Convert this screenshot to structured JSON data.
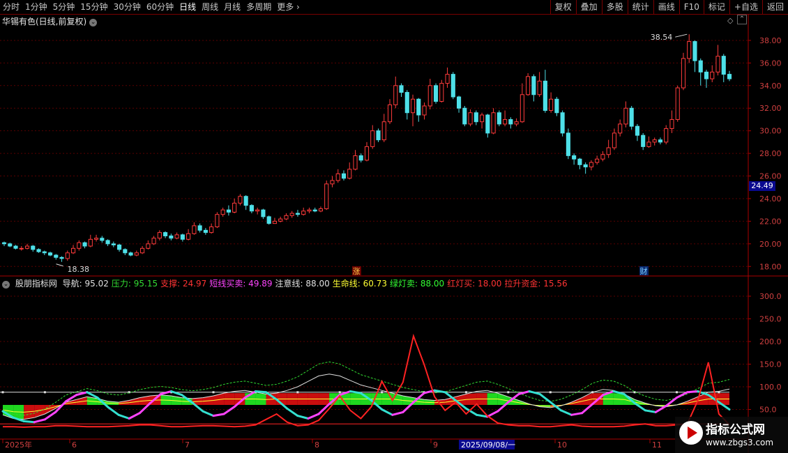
{
  "toolbar": {
    "tabs": [
      "分时",
      "1分钟",
      "5分钟",
      "15分钟",
      "30分钟",
      "60分钟",
      "日线",
      "周线",
      "月线",
      "多周期",
      "更多"
    ],
    "active_tab": "日线",
    "right_tabs": [
      "复权",
      "叠加",
      "多股",
      "统计",
      "画线",
      "F10",
      "标记",
      "+自选",
      "返回"
    ]
  },
  "chart_header": {
    "title": "华锡有色(日线,前复权)"
  },
  "indicator_header": {
    "name": "股朋指标网",
    "items": [
      {
        "label": "导航: 95.02",
        "color": "#e0e0e0"
      },
      {
        "label": "压力: 95.15",
        "color": "#33dd33"
      },
      {
        "label": "支撑: 24.97",
        "color": "#ff3333"
      },
      {
        "label": "短线买卖: 49.89",
        "color": "#ff44ff"
      },
      {
        "label": "注意线: 88.00",
        "color": "#e0e0e0"
      },
      {
        "label": "生命线: 60.73",
        "color": "#ffff33"
      },
      {
        "label": "绿灯卖: 88.00",
        "color": "#33ff33"
      },
      {
        "label": "红灯买: 18.00",
        "color": "#ff3333"
      },
      {
        "label": "拉升资金: 15.56",
        "color": "#ff3333"
      }
    ]
  },
  "current_price": "24.49",
  "markers": {
    "zhang": "涨",
    "cai": "财"
  },
  "watermark": {
    "title": "指标公式网",
    "url": "www.zbgs3.com"
  },
  "chart_data": [
    {
      "type": "candlestick",
      "title": "华锡有色(日线,前复权)",
      "y_ticks": [
        "38.00",
        "36.00",
        "34.00",
        "32.00",
        "30.00",
        "28.00",
        "26.00",
        "24.00",
        "22.00",
        "20.00",
        "18.00"
      ],
      "ylim": [
        17.4,
        39.6
      ],
      "high_annotation": "38.54",
      "low_annotation": "18.38",
      "candles": [
        [
          20.1,
          20.0,
          20.2,
          19.8
        ],
        [
          20.0,
          19.8,
          20.1,
          19.7
        ],
        [
          19.8,
          19.6,
          19.9,
          19.5
        ],
        [
          19.6,
          19.6,
          19.8,
          19.4
        ],
        [
          19.6,
          19.8,
          20.0,
          19.5
        ],
        [
          19.8,
          19.5,
          19.9,
          19.3
        ],
        [
          19.5,
          19.3,
          19.6,
          19.2
        ],
        [
          19.3,
          19.2,
          19.4,
          19.0
        ],
        [
          19.2,
          19.0,
          19.3,
          18.9
        ],
        [
          19.0,
          18.8,
          19.1,
          18.6
        ],
        [
          18.8,
          18.7,
          18.9,
          18.4
        ],
        [
          18.7,
          19.2,
          19.4,
          18.5
        ],
        [
          19.2,
          19.6,
          19.9,
          19.1
        ],
        [
          19.6,
          20.1,
          20.3,
          19.4
        ],
        [
          20.1,
          19.8,
          20.2,
          19.6
        ],
        [
          19.8,
          20.4,
          20.8,
          19.7
        ],
        [
          20.4,
          20.5,
          20.8,
          20.2
        ],
        [
          20.5,
          20.3,
          20.7,
          20.1
        ],
        [
          20.3,
          20.0,
          20.4,
          19.8
        ],
        [
          20.0,
          19.9,
          20.2,
          19.7
        ],
        [
          19.9,
          19.5,
          20.0,
          19.3
        ],
        [
          19.5,
          19.2,
          19.6,
          19.0
        ],
        [
          19.2,
          19.0,
          19.3,
          18.9
        ],
        [
          19.0,
          19.2,
          19.4,
          18.9
        ],
        [
          19.2,
          19.6,
          19.8,
          19.1
        ],
        [
          19.6,
          20.0,
          20.3,
          19.5
        ],
        [
          20.0,
          20.5,
          20.7,
          19.9
        ],
        [
          20.5,
          21.0,
          21.2,
          20.3
        ],
        [
          21.0,
          20.7,
          21.1,
          20.5
        ],
        [
          20.7,
          20.5,
          20.9,
          20.3
        ],
        [
          20.5,
          20.8,
          21.0,
          20.4
        ],
        [
          20.8,
          20.4,
          20.9,
          20.2
        ],
        [
          20.4,
          20.9,
          21.3,
          20.3
        ],
        [
          20.9,
          21.6,
          21.9,
          20.8
        ],
        [
          21.6,
          21.2,
          21.8,
          21.0
        ],
        [
          21.2,
          21.0,
          21.4,
          20.8
        ],
        [
          21.0,
          21.5,
          21.8,
          20.9
        ],
        [
          21.5,
          22.6,
          22.8,
          21.4
        ],
        [
          22.6,
          23.0,
          23.2,
          22.4
        ],
        [
          23.0,
          22.8,
          23.4,
          22.5
        ],
        [
          22.8,
          23.6,
          24.0,
          22.7
        ],
        [
          23.6,
          24.2,
          24.4,
          23.4
        ],
        [
          24.2,
          23.4,
          24.3,
          23.0
        ],
        [
          23.4,
          22.9,
          23.5,
          22.7
        ],
        [
          22.9,
          23.0,
          23.2,
          22.6
        ],
        [
          23.0,
          22.4,
          23.1,
          22.2
        ],
        [
          22.4,
          21.8,
          22.5,
          21.7
        ],
        [
          21.8,
          22.0,
          22.3,
          21.8
        ],
        [
          22.0,
          22.2,
          22.4,
          21.9
        ],
        [
          22.2,
          22.5,
          22.7,
          22.1
        ],
        [
          22.5,
          22.7,
          22.9,
          22.3
        ],
        [
          22.7,
          22.6,
          23.0,
          22.4
        ],
        [
          22.6,
          22.9,
          23.2,
          22.5
        ],
        [
          22.9,
          23.0,
          23.2,
          22.7
        ],
        [
          23.0,
          22.9,
          23.2,
          22.8
        ],
        [
          22.9,
          23.1,
          23.3,
          22.8
        ],
        [
          23.1,
          25.3,
          25.6,
          23.0
        ],
        [
          25.3,
          25.6,
          26.0,
          25.0
        ],
        [
          25.6,
          26.2,
          26.6,
          25.4
        ],
        [
          26.2,
          25.8,
          26.5,
          25.6
        ],
        [
          25.8,
          26.6,
          27.2,
          25.7
        ],
        [
          26.6,
          27.8,
          28.3,
          26.5
        ],
        [
          27.8,
          27.4,
          28.0,
          27.2
        ],
        [
          27.4,
          28.6,
          29.0,
          27.3
        ],
        [
          28.6,
          30.0,
          30.5,
          28.4
        ],
        [
          30.0,
          29.2,
          30.2,
          29.0
        ],
        [
          29.2,
          30.8,
          31.5,
          29.0
        ],
        [
          30.8,
          32.3,
          32.8,
          30.6
        ],
        [
          32.3,
          34.0,
          34.8,
          32.0
        ],
        [
          34.0,
          33.4,
          34.2,
          33.0
        ],
        [
          33.4,
          31.6,
          33.6,
          31.0
        ],
        [
          31.6,
          32.8,
          33.2,
          30.4
        ],
        [
          32.8,
          31.4,
          32.9,
          30.8
        ],
        [
          31.4,
          32.2,
          32.5,
          31.0
        ],
        [
          32.2,
          34.0,
          34.6,
          31.9
        ],
        [
          34.0,
          32.6,
          34.2,
          32.4
        ],
        [
          32.6,
          34.2,
          34.5,
          32.5
        ],
        [
          34.2,
          35.0,
          35.6,
          33.8
        ],
        [
          35.0,
          33.0,
          35.2,
          32.8
        ],
        [
          33.0,
          32.0,
          33.1,
          31.6
        ],
        [
          32.0,
          30.6,
          32.2,
          30.4
        ],
        [
          30.6,
          31.6,
          31.9,
          30.4
        ],
        [
          31.6,
          30.8,
          31.8,
          30.5
        ],
        [
          30.8,
          31.4,
          31.6,
          30.2
        ],
        [
          31.4,
          29.8,
          31.5,
          29.4
        ],
        [
          29.8,
          31.6,
          32.0,
          29.7
        ],
        [
          31.6,
          30.6,
          31.8,
          30.4
        ],
        [
          30.6,
          31.0,
          31.8,
          30.4
        ],
        [
          31.0,
          30.6,
          31.2,
          30.2
        ],
        [
          30.6,
          30.8,
          31.1,
          30.4
        ],
        [
          30.8,
          33.2,
          34.2,
          30.7
        ],
        [
          33.2,
          34.8,
          35.1,
          33.1
        ],
        [
          34.8,
          33.2,
          35.0,
          32.6
        ],
        [
          33.2,
          34.4,
          35.2,
          33.0
        ],
        [
          34.4,
          31.8,
          35.4,
          31.6
        ],
        [
          31.8,
          32.8,
          33.4,
          31.6
        ],
        [
          32.8,
          31.6,
          33.0,
          31.3
        ],
        [
          31.6,
          29.8,
          31.8,
          29.5
        ],
        [
          29.8,
          27.8,
          30.2,
          27.5
        ],
        [
          27.8,
          27.5,
          28.0,
          27.0
        ],
        [
          27.5,
          27.0,
          27.6,
          26.6
        ],
        [
          27.0,
          26.8,
          27.2,
          26.2
        ],
        [
          26.8,
          27.2,
          27.4,
          26.5
        ],
        [
          27.2,
          27.5,
          27.8,
          27.0
        ],
        [
          27.5,
          27.9,
          28.2,
          27.3
        ],
        [
          27.9,
          28.5,
          29.2,
          27.6
        ],
        [
          28.5,
          29.8,
          30.2,
          28.3
        ],
        [
          29.8,
          30.6,
          31.0,
          29.5
        ],
        [
          30.6,
          32.0,
          32.6,
          30.3
        ],
        [
          32.0,
          30.4,
          32.2,
          30.1
        ],
        [
          30.4,
          29.6,
          30.6,
          29.1
        ],
        [
          29.6,
          28.6,
          29.8,
          28.3
        ],
        [
          28.6,
          29.0,
          29.5,
          28.5
        ],
        [
          29.0,
          29.2,
          29.4,
          28.7
        ],
        [
          29.2,
          29.0,
          29.4,
          28.8
        ],
        [
          29.0,
          30.2,
          30.5,
          28.8
        ],
        [
          30.2,
          31.0,
          31.8,
          29.8
        ],
        [
          31.0,
          33.8,
          34.0,
          30.8
        ],
        [
          33.8,
          36.4,
          36.9,
          33.6
        ],
        [
          36.4,
          37.9,
          38.54,
          36.0
        ],
        [
          37.9,
          36.2,
          38.0,
          35.2
        ],
        [
          36.2,
          35.2,
          36.4,
          34.0
        ],
        [
          35.2,
          34.6,
          35.4,
          33.8
        ],
        [
          34.6,
          35.2,
          35.8,
          34.3
        ],
        [
          35.2,
          36.6,
          37.6,
          34.9
        ],
        [
          36.6,
          35.0,
          36.8,
          34.3
        ],
        [
          35.0,
          34.6,
          35.3,
          34.4
        ]
      ]
    },
    {
      "type": "line",
      "title": "股朋指标网",
      "y_ticks": [
        "300.0",
        "250.0",
        "200.0",
        "150.0",
        "100.0",
        "50.0"
      ],
      "ylim": [
        0,
        320
      ],
      "x_labels": [
        "2025年",
        "6",
        "7",
        "8",
        "9",
        "2025/09/08/一",
        "10",
        "11"
      ],
      "series": [
        {
          "name": "短线买卖",
          "color": "#ff44ff",
          "values": [
            46,
            32,
            24,
            22,
            28,
            44,
            68,
            82,
            88,
            76,
            55,
            38,
            30,
            42,
            64,
            84,
            90,
            82,
            65,
            46,
            36,
            40,
            56,
            76,
            90,
            88,
            72,
            52,
            36,
            30,
            40,
            62,
            82,
            90,
            86,
            70,
            50,
            38,
            44,
            66,
            86,
            92,
            88,
            70,
            52,
            38,
            34,
            46,
            66,
            84,
            90,
            84,
            66,
            48,
            38,
            42,
            62,
            82,
            90,
            84,
            64,
            48,
            44,
            58,
            76,
            88,
            90,
            82,
            66,
            50
          ]
        },
        {
          "name": "导航",
          "color": "#e0e0e0",
          "values": [
            38,
            30,
            28,
            32,
            40,
            52,
            66,
            72,
            78,
            74,
            68,
            66,
            70,
            76,
            80,
            82,
            80,
            76,
            74,
            76,
            80,
            86,
            90,
            92,
            88,
            84,
            86,
            92,
            100,
            112,
            124,
            128,
            124,
            114,
            104,
            98,
            92,
            86,
            80,
            76,
            72,
            70,
            72,
            78,
            84,
            90,
            92,
            86,
            78,
            70,
            62,
            56,
            54,
            58,
            66,
            76,
            88,
            94,
            92,
            84,
            72,
            64,
            58,
            56,
            60,
            68,
            78,
            88,
            90,
            95
          ]
        },
        {
          "name": "拉升资金",
          "color": "#ff2222",
          "values": [
            12,
            12,
            11,
            12,
            12,
            14,
            14,
            13,
            12,
            12,
            12,
            13,
            14,
            16,
            16,
            14,
            12,
            12,
            13,
            14,
            14,
            13,
            12,
            13,
            16,
            28,
            40,
            22,
            14,
            16,
            26,
            52,
            80,
            48,
            30,
            56,
            112,
            70,
            110,
            212,
            150,
            78,
            48,
            66,
            40,
            62,
            36,
            20,
            16,
            14,
            14,
            12,
            12,
            14,
            16,
            13,
            12,
            12,
            12,
            13,
            16,
            18,
            14,
            14,
            16,
            18,
            70,
            154,
            40,
            16
          ]
        }
      ],
      "constant_lines": [
        {
          "name": "注意线",
          "value": 88,
          "color": "#e0e0e0"
        },
        {
          "name": "红灯买",
          "value": 18,
          "color": "#ff2222"
        }
      ]
    }
  ]
}
